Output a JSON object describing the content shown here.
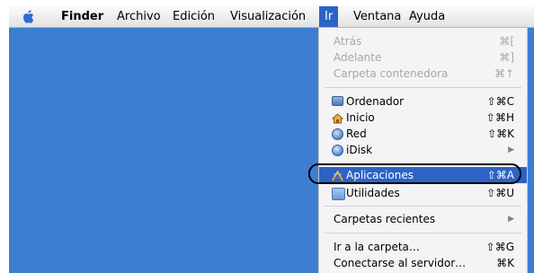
{
  "menubar": {
    "apple": "",
    "items": [
      "Finder",
      "Archivo",
      "Edición",
      "Visualización",
      "Ir",
      "Ventana",
      "Ayuda"
    ]
  },
  "ir_menu": {
    "items": [
      {
        "label": "Atrás",
        "shortcut": "⌘[",
        "enabled": false
      },
      {
        "label": "Adelante",
        "shortcut": "⌘]",
        "enabled": false
      },
      {
        "label": "Carpeta contenedora",
        "shortcut": "⌘↑",
        "enabled": false
      },
      {
        "label": "Ordenador",
        "shortcut": "⇧⌘C",
        "icon": "computer-icon"
      },
      {
        "label": "Inicio",
        "shortcut": "⇧⌘H",
        "icon": "home-icon"
      },
      {
        "label": "Red",
        "shortcut": "⇧⌘K",
        "icon": "network-icon"
      },
      {
        "label": "iDisk",
        "shortcut": "▶",
        "icon": "idisk-icon"
      },
      {
        "label": "Aplicaciones",
        "shortcut": "⇧⌘A",
        "icon": "applications-icon",
        "selected": true
      },
      {
        "label": "Utilidades",
        "shortcut": "⇧⌘U",
        "icon": "folder-icon"
      },
      {
        "label": "Carpetas recientes",
        "shortcut": "▶"
      },
      {
        "label": "Ir a la carpeta…",
        "shortcut": "⇧⌘G"
      },
      {
        "label": "Conectarse al servidor…",
        "shortcut": "⌘K"
      }
    ]
  },
  "colors": {
    "desktop": "#3d7ed1",
    "selection": "#2d63c4",
    "disabled_text": "#a7a7a7"
  }
}
